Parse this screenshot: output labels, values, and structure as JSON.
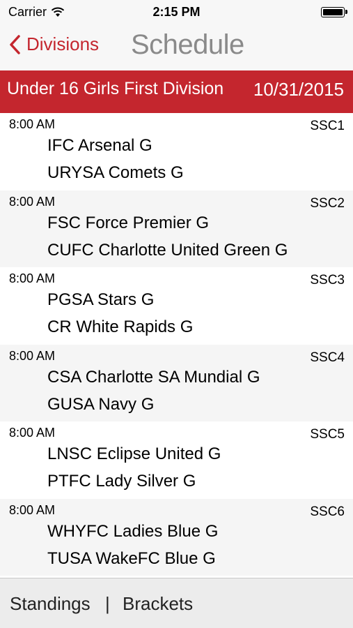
{
  "status": {
    "carrier": "Carrier",
    "time": "2:15 PM"
  },
  "nav": {
    "back_label": "Divisions",
    "title": "Schedule"
  },
  "banner": {
    "division": "Under 16 Girls First Division",
    "date": "10/31/2015"
  },
  "games": [
    {
      "time": "8:00 AM",
      "field": "SSC1",
      "home": "IFC Arsenal G",
      "away": "URYSA Comets G"
    },
    {
      "time": "8:00 AM",
      "field": "SSC2",
      "home": "FSC Force Premier G",
      "away": "CUFC Charlotte United Green G"
    },
    {
      "time": "8:00 AM",
      "field": "SSC3",
      "home": "PGSA Stars G",
      "away": "CR White Rapids G"
    },
    {
      "time": "8:00 AM",
      "field": "SSC4",
      "home": "CSA Charlotte SA Mundial G",
      "away": "GUSA Navy G"
    },
    {
      "time": "8:00 AM",
      "field": "SSC5",
      "home": "LNSC Eclipse United G",
      "away": "PTFC Lady Silver G"
    },
    {
      "time": "8:00 AM",
      "field": "SSC6",
      "home": "WHYFC Ladies Blue G",
      "away": "TUSA WakeFC Blue G"
    }
  ],
  "tabs": {
    "standings": "Standings",
    "separator": "|",
    "brackets": "Brackets"
  },
  "colors": {
    "accent": "#c4262e",
    "title_gray": "#8a8a8a"
  }
}
